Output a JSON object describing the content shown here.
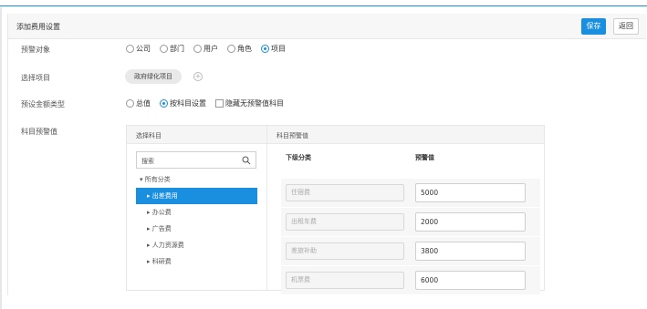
{
  "page": {
    "title": "添加费用设置"
  },
  "toolbar": {
    "save_label": "保存",
    "back_label": "返回"
  },
  "form": {
    "target": {
      "label": "预警对象",
      "options": [
        "公司",
        "部门",
        "用户",
        "角色",
        "项目"
      ],
      "selected": "项目"
    },
    "project": {
      "label": "选择项目",
      "tag": "政府绿化项目"
    },
    "amount_type": {
      "label": "预设金额类型",
      "options": [
        "总值",
        "按科目设置"
      ],
      "selected": "按科目设置",
      "checkbox_label": "隐藏无预警值科目"
    },
    "subject_threshold": {
      "label": "科目预警值"
    }
  },
  "subjects": {
    "header_left": "选择科目",
    "header_right": "科目预警值",
    "search_placeholder": "搜索",
    "tree": {
      "root": "▾ 所有分类",
      "items": [
        "▸ 出差费用",
        "▸ 办公费",
        "▸ 广告费",
        "▸ 人力资源费",
        "▸ 科研费"
      ],
      "selected_index": 0
    },
    "table": {
      "columns": [
        "下级分类",
        "预警值"
      ],
      "rows": [
        {
          "name": "住宿费",
          "value": "5000"
        },
        {
          "name": "出租车费",
          "value": "2000"
        },
        {
          "name": "差旅补助",
          "value": "3800"
        },
        {
          "name": "机票费",
          "value": "6000"
        }
      ]
    }
  },
  "colors": {
    "accent": "#1a8fe0"
  }
}
